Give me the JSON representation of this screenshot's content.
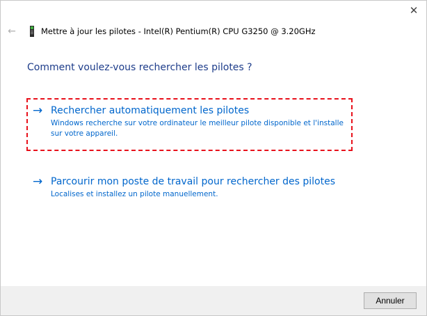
{
  "window": {
    "title": "Mettre à jour les pilotes - Intel(R) Pentium(R) CPU G3250 @ 3.20GHz",
    "close_glyph": "✕",
    "back_glyph": "←"
  },
  "heading": "Comment voulez-vous rechercher les pilotes ?",
  "options": [
    {
      "arrow": "→",
      "title": "Rechercher automatiquement les pilotes",
      "description": "Windows recherche sur votre ordinateur le meilleur pilote disponible et l'installe sur votre appareil."
    },
    {
      "arrow": "→",
      "title": "Parcourir mon poste de travail pour rechercher des pilotes",
      "description": "Localises et installez un pilote manuellement."
    }
  ],
  "footer": {
    "cancel_label": "Annuler"
  },
  "colors": {
    "link_blue": "#0066cc",
    "heading_blue": "#1d3c8a",
    "highlight_red": "#e8101a",
    "footer_bg": "#f0f0f0"
  },
  "icons": {
    "device": "device-icon",
    "back": "back-arrow-icon",
    "close": "close-icon",
    "option_arrow": "right-arrow-icon"
  }
}
